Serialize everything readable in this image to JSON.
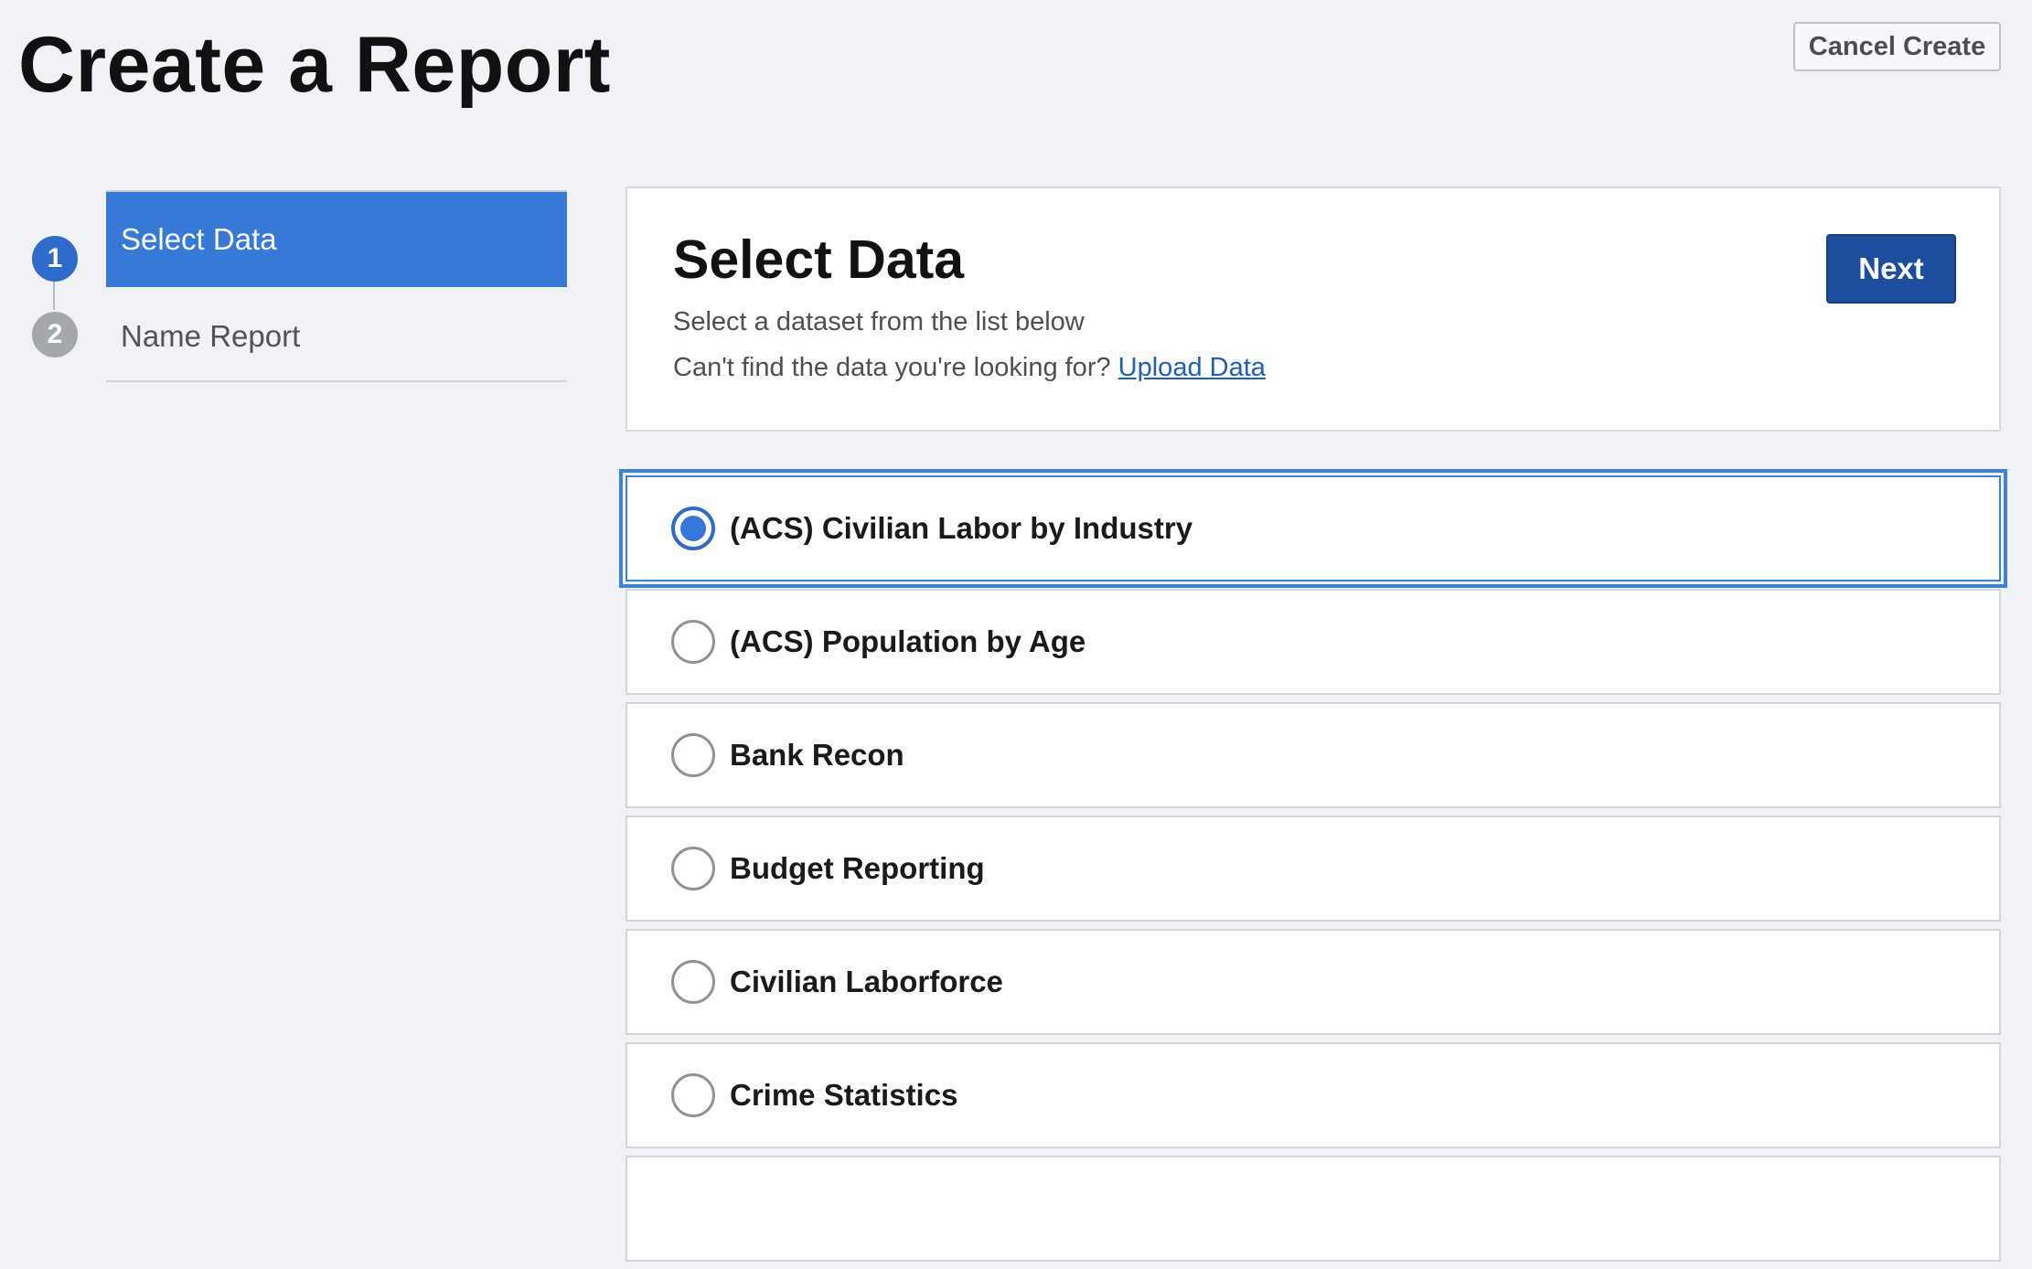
{
  "page": {
    "title": "Create a Report",
    "cancel_label": "Cancel Create"
  },
  "stepper": {
    "steps": [
      {
        "number": "1",
        "label": "Select Data",
        "state": "active"
      },
      {
        "number": "2",
        "label": "Name Report",
        "state": "inactive"
      }
    ]
  },
  "section": {
    "title": "Select Data",
    "subtitle": "Select a dataset from the list below",
    "help_text": "Can't find the data you're looking for?",
    "upload_link": "Upload Data",
    "next_label": "Next"
  },
  "datasets": {
    "items": [
      {
        "label": "(ACS) Civilian Labor by Industry",
        "selected": true
      },
      {
        "label": "(ACS) Population by Age",
        "selected": false
      },
      {
        "label": "Bank Recon",
        "selected": false
      },
      {
        "label": "Budget Reporting",
        "selected": false
      },
      {
        "label": "Civilian Laborforce",
        "selected": false
      },
      {
        "label": "Crime Statistics",
        "selected": false
      }
    ]
  },
  "colors": {
    "background": "#f0f2f5",
    "accent": "#3679d6",
    "primary_button": "#1d4e9e",
    "link": "#1f5fb8"
  }
}
